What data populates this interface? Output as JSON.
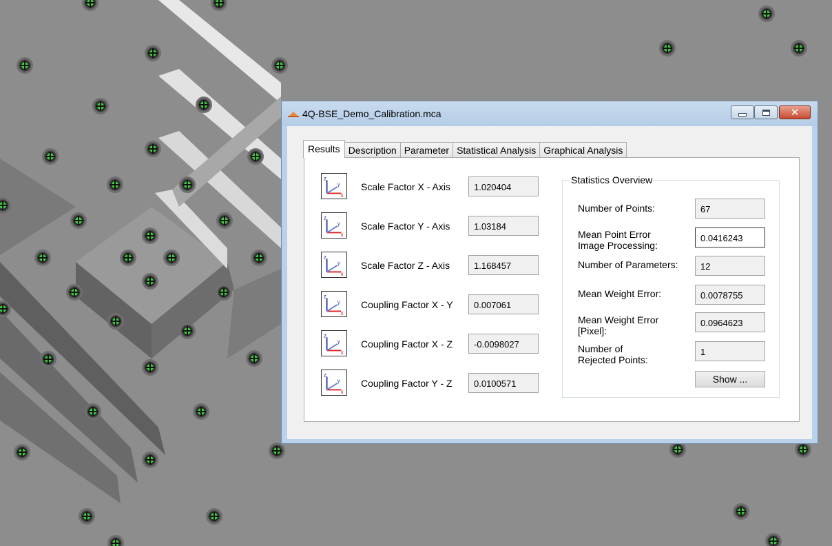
{
  "window": {
    "title": "4Q-BSE_Demo_Calibration.mca",
    "controls": {
      "minimize": "minimize",
      "maximize": "maximize",
      "close": "close"
    }
  },
  "tabs": [
    {
      "label": "Results",
      "active": true
    },
    {
      "label": "Description",
      "active": false
    },
    {
      "label": "Parameter",
      "active": false
    },
    {
      "label": "Statistical Analysis",
      "active": false
    },
    {
      "label": "Graphical Analysis",
      "active": false
    }
  ],
  "results": [
    {
      "label": "Scale Factor X - Axis",
      "value": "1.020404"
    },
    {
      "label": "Scale Factor Y - Axis",
      "value": "1.03184"
    },
    {
      "label": "Scale Factor Z - Axis",
      "value": "1.168457"
    },
    {
      "label": "Coupling Factor X - Y",
      "value": "0.007061"
    },
    {
      "label": "Coupling Factor X - Z",
      "value": "-0.0098027"
    },
    {
      "label": "Coupling Factor Y - Z",
      "value": "0.0100571"
    }
  ],
  "axis_icon": {
    "z": "z",
    "y": "y",
    "x": "x"
  },
  "statistics": {
    "title": "Statistics Overview",
    "items": [
      {
        "label_lines": [
          "Number of Points:"
        ],
        "value": "67"
      },
      {
        "label_lines": [
          "Mean Point Error",
          "Image Processing:"
        ],
        "value": "0.0416243"
      },
      {
        "label_lines": [
          "Number of Parameters:"
        ],
        "value": "12"
      },
      {
        "label_lines": [
          "Mean Weight Error:"
        ],
        "value": "0.0078755"
      },
      {
        "label_lines": [
          "Mean Weight Error",
          "[Pixel]:"
        ],
        "value": "0.0964623"
      },
      {
        "label_lines": [
          "Number of",
          "Rejected Points:"
        ],
        "value": "1"
      }
    ],
    "show_button": "Show ..."
  },
  "colors": {
    "marker": "#3ccf3c",
    "titlebar": "#b9d1ea",
    "close_button": "#c74a32"
  }
}
